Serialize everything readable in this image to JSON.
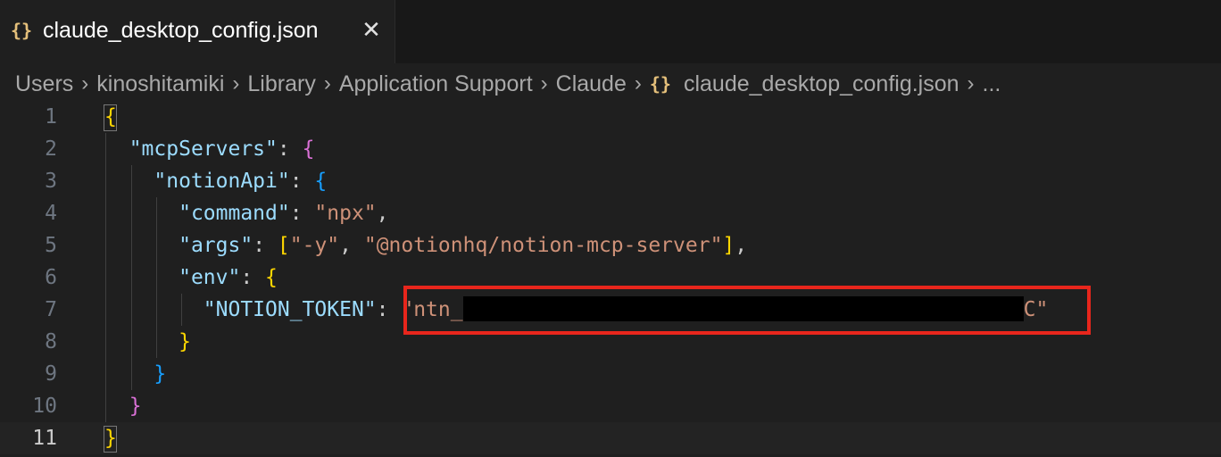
{
  "tab": {
    "icon": "{}",
    "label": "claude_desktop_config.json",
    "close": "✕"
  },
  "breadcrumb": {
    "items": [
      "Users",
      "kinoshitamiki",
      "Library",
      "Application Support",
      "Claude"
    ],
    "file_icon": "{}",
    "file": "claude_desktop_config.json",
    "more": "...",
    "sep": "›"
  },
  "editor": {
    "line_numbers": [
      "1",
      "2",
      "3",
      "4",
      "5",
      "6",
      "7",
      "8",
      "9",
      "10",
      "11"
    ],
    "current_line": "11",
    "tokens": {
      "mcpServers_key": "\"mcpServers\"",
      "notionApi_key": "\"notionApi\"",
      "command_key": "\"command\"",
      "command_val": "\"npx\"",
      "args_key": "\"args\"",
      "args_val1": "\"-y\"",
      "args_val2": "\"@notionhq/notion-mcp-server\"",
      "env_key": "\"env\"",
      "token_key": "\"NOTION_TOKEN\"",
      "token_prefix": "\"ntn_",
      "token_suffix": "C\""
    }
  },
  "colors": {
    "background": "#1f1f1f",
    "key": "#9cdcfe",
    "string": "#ce9178",
    "highlight_border": "#e8261c",
    "redaction": "#000000"
  }
}
